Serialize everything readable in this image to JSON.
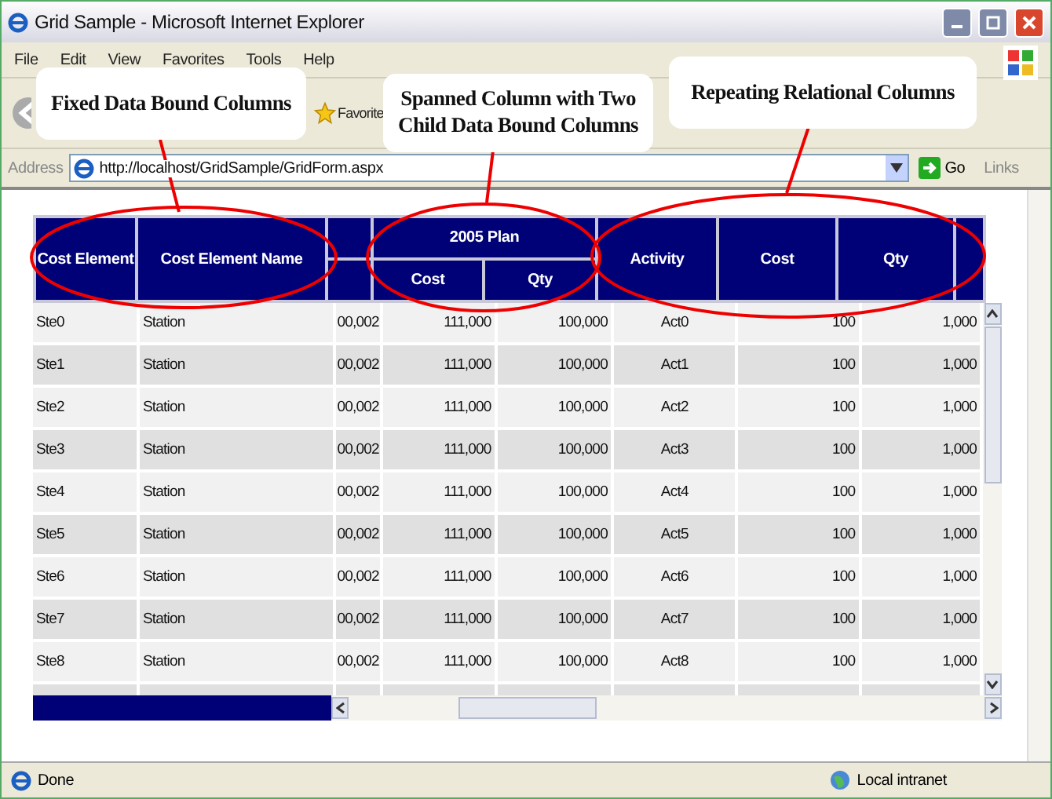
{
  "window": {
    "title": "Grid Sample - Microsoft Internet Explorer"
  },
  "menu": [
    "File",
    "Edit",
    "View",
    "Favorites",
    "Tools",
    "Help"
  ],
  "toolbar": {
    "favorites": "Favorite"
  },
  "address_bar": {
    "label": "Address",
    "url": "http://localhost/GridSample/GridForm.aspx",
    "go": "Go",
    "links": "Links"
  },
  "grid": {
    "group_header": "2005 Plan",
    "columns": [
      "Cost Element",
      "Cost Element Name",
      "",
      "Cost",
      "Qty",
      "Activity",
      "Cost",
      "Qty",
      ""
    ],
    "rows": [
      [
        "Ste0",
        "Station",
        "00,002",
        "111,000",
        "100,000",
        "Act0",
        "100",
        "1,000"
      ],
      [
        "Ste1",
        "Station",
        "00,002",
        "111,000",
        "100,000",
        "Act1",
        "100",
        "1,000"
      ],
      [
        "Ste2",
        "Station",
        "00,002",
        "111,000",
        "100,000",
        "Act2",
        "100",
        "1,000"
      ],
      [
        "Ste3",
        "Station",
        "00,002",
        "111,000",
        "100,000",
        "Act3",
        "100",
        "1,000"
      ],
      [
        "Ste4",
        "Station",
        "00,002",
        "111,000",
        "100,000",
        "Act4",
        "100",
        "1,000"
      ],
      [
        "Ste5",
        "Station",
        "00,002",
        "111,000",
        "100,000",
        "Act5",
        "100",
        "1,000"
      ],
      [
        "Ste6",
        "Station",
        "00,002",
        "111,000",
        "100,000",
        "Act6",
        "100",
        "1,000"
      ],
      [
        "Ste7",
        "Station",
        "00,002",
        "111,000",
        "100,000",
        "Act7",
        "100",
        "1,000"
      ],
      [
        "Ste8",
        "Station",
        "00,002",
        "111,000",
        "100,000",
        "Act8",
        "100",
        "1,000"
      ]
    ]
  },
  "callouts": [
    "Fixed Data Bound Columns",
    "Spanned Column with Two Child Data Bound Columns",
    "Repeating Relational Columns"
  ],
  "status_bar": {
    "text": "Done",
    "zone": "Local intranet"
  }
}
